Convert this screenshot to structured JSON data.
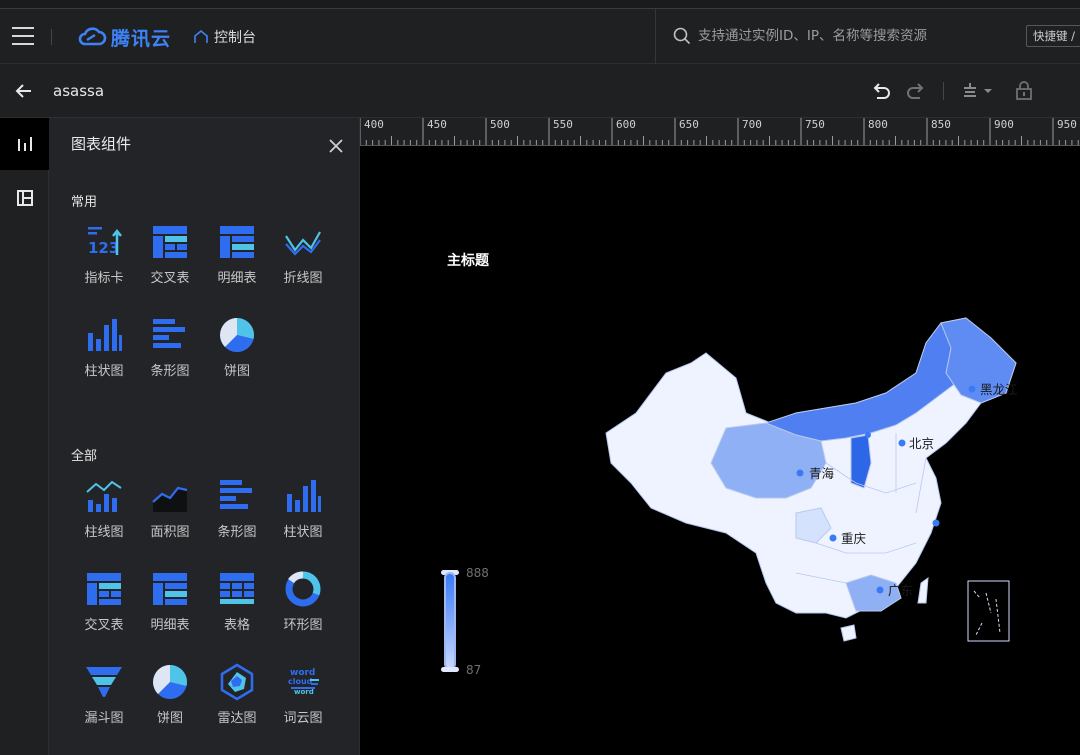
{
  "topbar": {
    "brand": "腾讯云",
    "console_label": "控制台",
    "search_placeholder": "支持通过实例ID、IP、名称等搜索资源",
    "shortcut_label": "快捷键 /"
  },
  "editor": {
    "doc_title": "asassa"
  },
  "panel": {
    "title": "图表组件",
    "section_common": "常用",
    "section_all": "全部",
    "common_items": [
      {
        "label": "指标卡",
        "icon": "kpi-card-icon"
      },
      {
        "label": "交叉表",
        "icon": "cross-table-icon"
      },
      {
        "label": "明细表",
        "icon": "detail-table-icon"
      },
      {
        "label": "折线图",
        "icon": "line-chart-icon"
      },
      {
        "label": "柱状图",
        "icon": "bar-chart-icon"
      },
      {
        "label": "条形图",
        "icon": "horizontal-bar-icon"
      },
      {
        "label": "饼图",
        "icon": "pie-chart-icon"
      }
    ],
    "all_items": [
      {
        "label": "柱线图",
        "icon": "bar-line-chart-icon"
      },
      {
        "label": "面积图",
        "icon": "area-chart-icon"
      },
      {
        "label": "条形图",
        "icon": "horizontal-bar-icon"
      },
      {
        "label": "柱状图",
        "icon": "bar-chart-icon"
      },
      {
        "label": "交叉表",
        "icon": "cross-table-icon"
      },
      {
        "label": "明细表",
        "icon": "detail-table-icon"
      },
      {
        "label": "表格",
        "icon": "table-icon"
      },
      {
        "label": "环形图",
        "icon": "donut-chart-icon"
      },
      {
        "label": "漏斗图",
        "icon": "funnel-chart-icon"
      },
      {
        "label": "饼图",
        "icon": "pie-chart-icon"
      },
      {
        "label": "雷达图",
        "icon": "radar-chart-icon"
      },
      {
        "label": "词云图",
        "icon": "word-cloud-icon"
      }
    ],
    "word_cloud_text": [
      "word",
      "cloud",
      "word"
    ]
  },
  "ruler": {
    "labels": [
      "400",
      "450",
      "500",
      "550",
      "600",
      "650",
      "700",
      "750",
      "800",
      "850",
      "900",
      "950"
    ]
  },
  "chart": {
    "title": "主标题",
    "legend_max": "888",
    "legend_min": "87",
    "province_labels": {
      "heilongjiang": "黑龙江",
      "beijing": "北京",
      "qinghai": "青海",
      "chongqing": "重庆",
      "guangdong": "广东"
    }
  },
  "colors": {
    "accent": "#3d83f7",
    "map_light": "#eef3ff",
    "map_mid": "#8fb0f5",
    "map_dark": "#4f7ff0",
    "map_darkest": "#2e66e8"
  }
}
